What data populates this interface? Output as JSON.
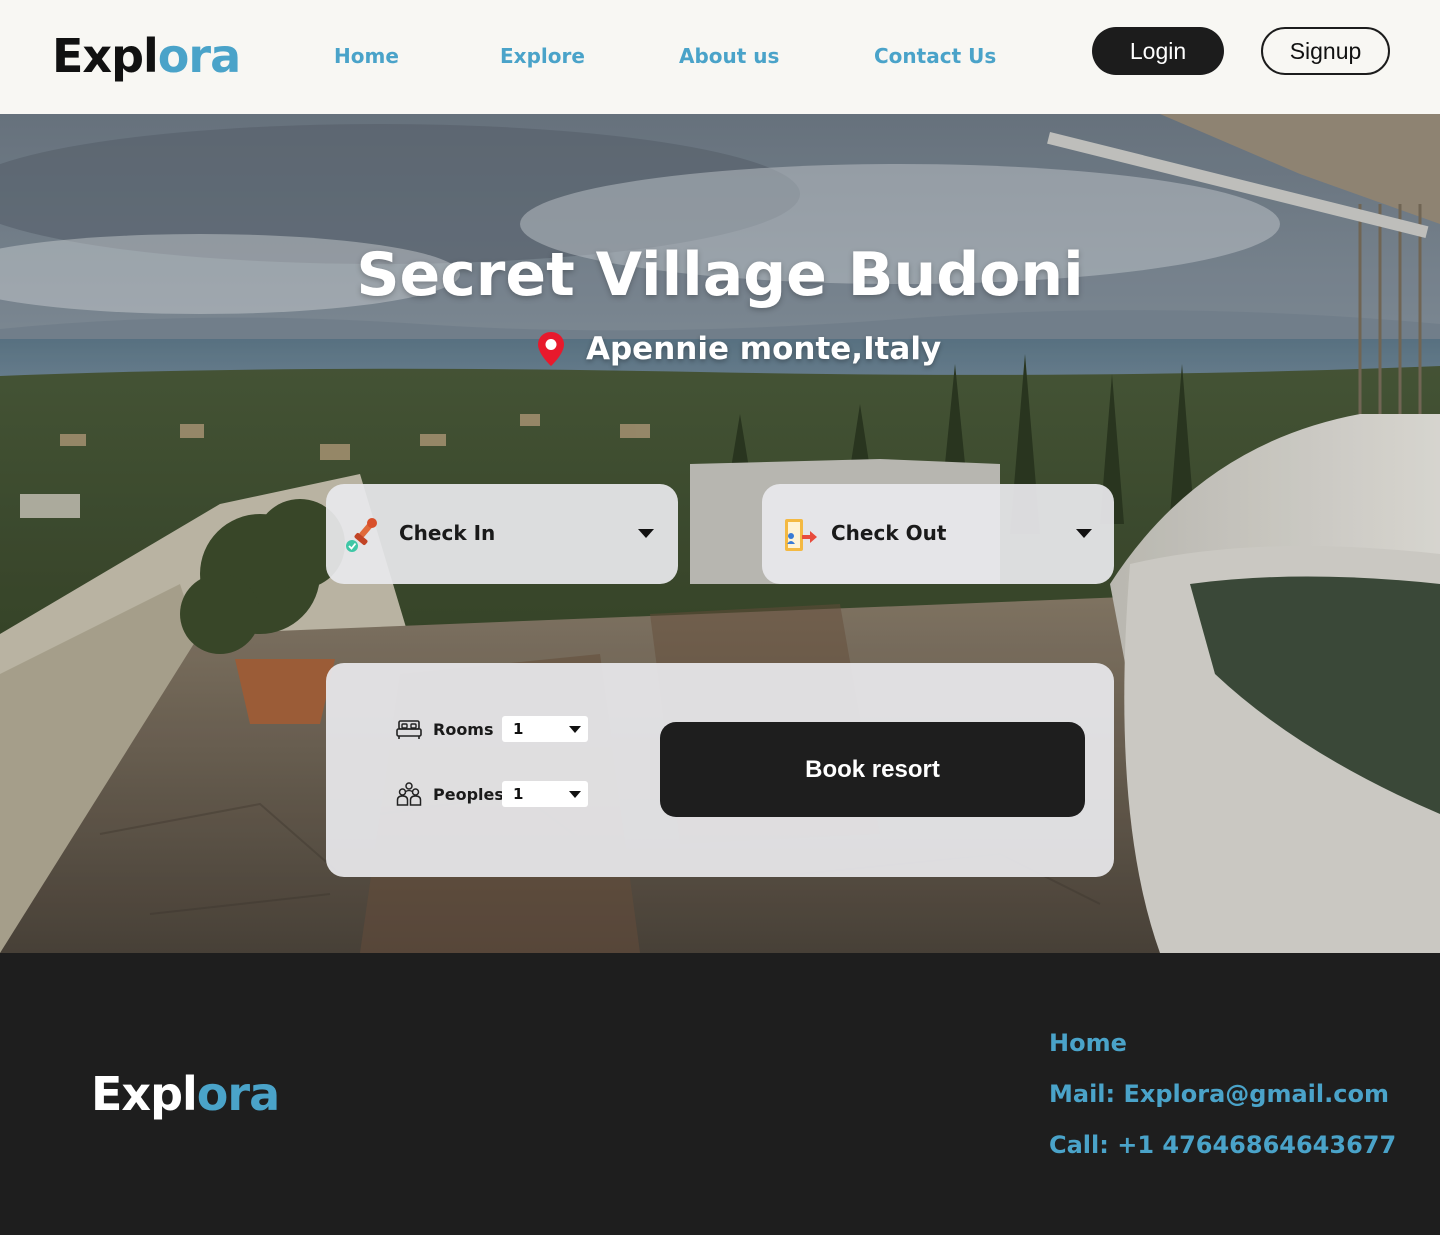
{
  "header": {
    "logo_a": "Expl",
    "logo_b": "ora",
    "nav": [
      "Home",
      "Explore",
      "About us",
      "Contact Us"
    ],
    "login_label": "Login",
    "signup_label": "Signup"
  },
  "hero": {
    "title": "Secret Village Budoni",
    "location": "Apennie monte,Italy",
    "check_in_label": "Check In",
    "check_out_label": "Check Out",
    "rooms_label": "Rooms",
    "rooms_value": "1",
    "peoples_label": "Peoples",
    "peoples_value": "1",
    "book_label": "Book resort"
  },
  "footer": {
    "logo_a": "Expl",
    "logo_b": "ora",
    "home_label": "Home",
    "mail_label": "Mail: Explora@gmail.com",
    "call_label": "Call: +1 47646864643677"
  },
  "colors": {
    "accent": "#4aa3c9",
    "dark": "#1e1e1e",
    "header_bg": "#f8f7f3",
    "pin_red": "#e8192c"
  }
}
